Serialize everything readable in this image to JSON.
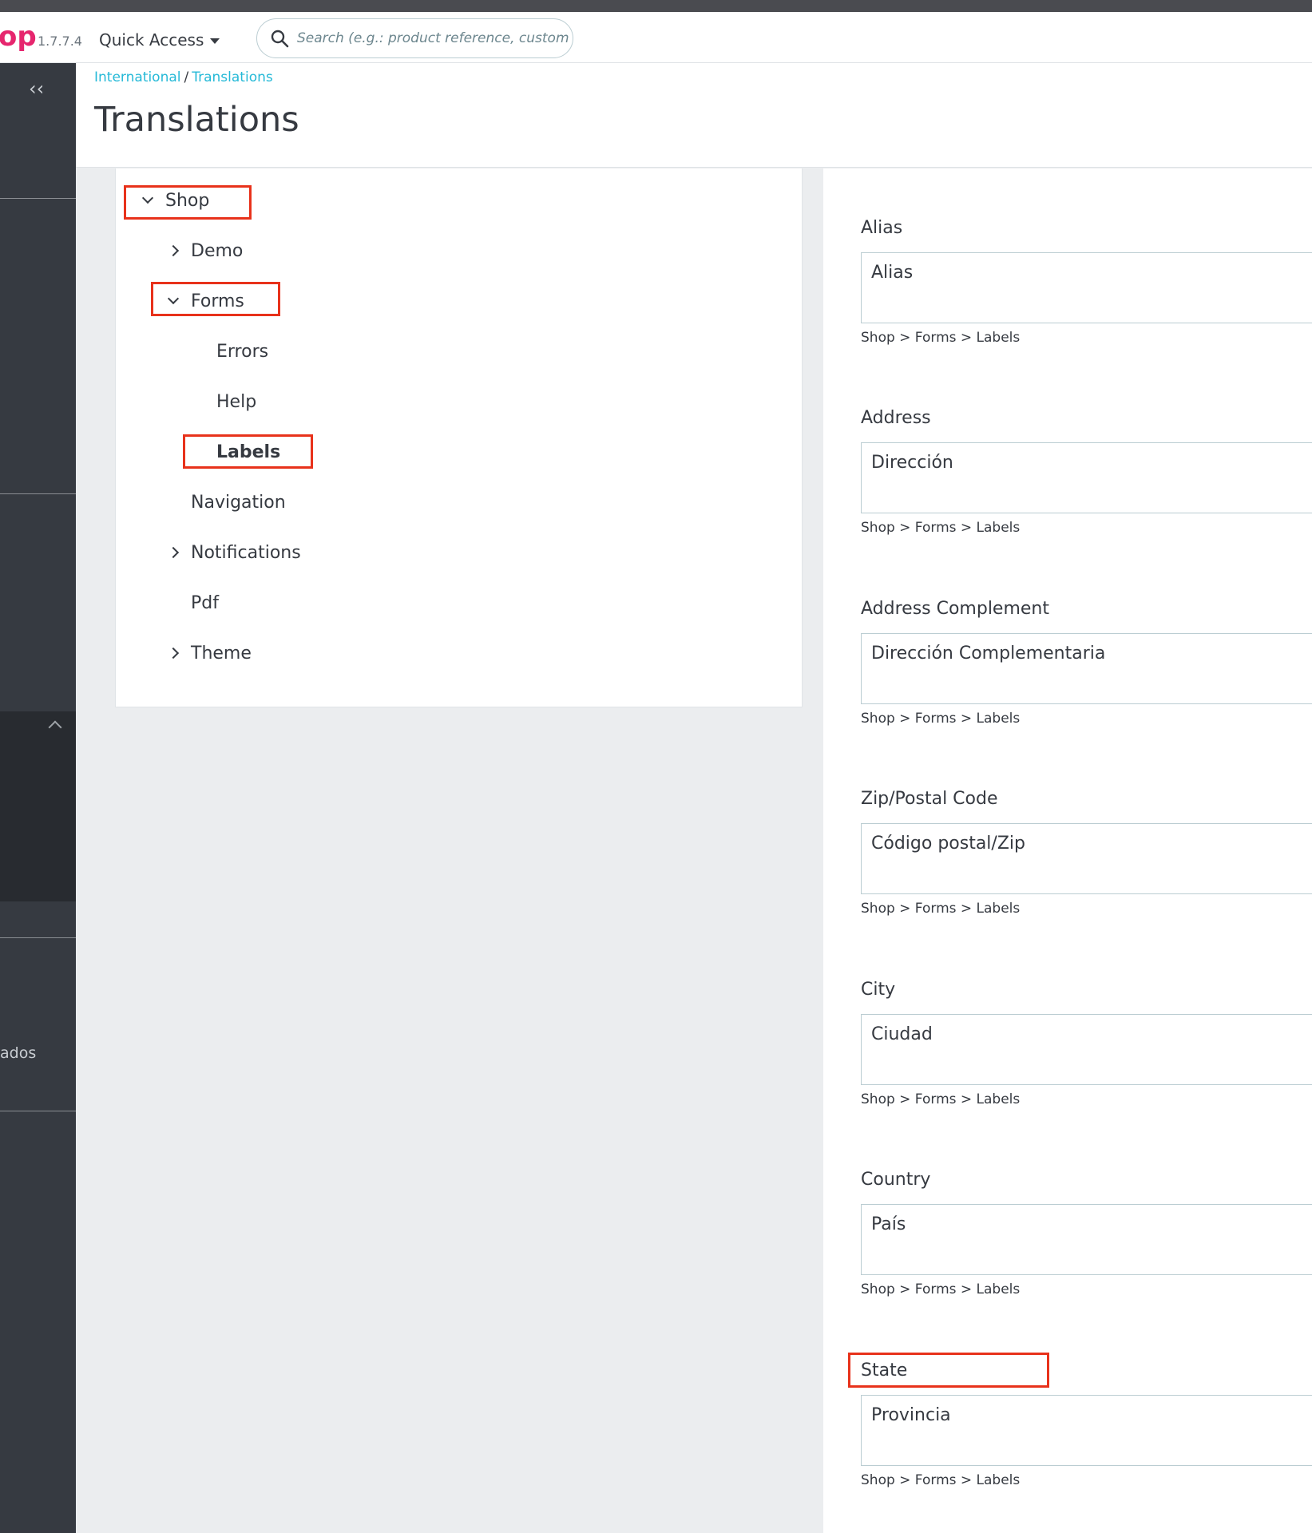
{
  "header": {
    "logo_text": "op",
    "version": "1.7.7.4",
    "quick_access_label": "Quick Access",
    "search_placeholder": "Search (e.g.: product reference, custome"
  },
  "sidebar": {
    "collapse_icon": "double-chevron-left-icon",
    "partial_text": "ados"
  },
  "breadcrumb": [
    "International",
    "Translations"
  ],
  "breadcrumb_separator": "/",
  "page_title": "Translations",
  "tree": [
    {
      "label": "Shop",
      "state": "expanded",
      "level": 0
    },
    {
      "label": "Demo",
      "state": "collapsed",
      "level": 1
    },
    {
      "label": "Forms",
      "state": "expanded",
      "level": 1
    },
    {
      "label": "Errors",
      "state": "leaf",
      "level": 2
    },
    {
      "label": "Help",
      "state": "leaf",
      "level": 2
    },
    {
      "label": "Labels",
      "state": "selected",
      "level": 2
    },
    {
      "label": "Navigation",
      "state": "leaf",
      "level": 1
    },
    {
      "label": "Notifications",
      "state": "collapsed",
      "level": 1
    },
    {
      "label": "Pdf",
      "state": "leaf",
      "level": 1
    },
    {
      "label": "Theme",
      "state": "collapsed",
      "level": 1
    }
  ],
  "fields": [
    {
      "label": "Alias",
      "value": "Alias",
      "path": "Shop > Forms > Labels"
    },
    {
      "label": "Address",
      "value": "Dirección",
      "path": "Shop > Forms > Labels"
    },
    {
      "label": "Address Complement",
      "value": "Dirección Complementaria",
      "path": "Shop > Forms > Labels"
    },
    {
      "label": "Zip/Postal Code",
      "value": "Código postal/Zip",
      "path": "Shop > Forms > Labels"
    },
    {
      "label": "City",
      "value": "Ciudad",
      "path": "Shop > Forms > Labels"
    },
    {
      "label": "Country",
      "value": "País",
      "path": "Shop > Forms > Labels"
    },
    {
      "label": "State",
      "value": "Provincia",
      "path": "Shop > Forms > Labels"
    }
  ],
  "colors": {
    "brand": "#e6266e",
    "link": "#25b9d7",
    "highlight": "#e8321b",
    "sidebar": "#363a41"
  }
}
